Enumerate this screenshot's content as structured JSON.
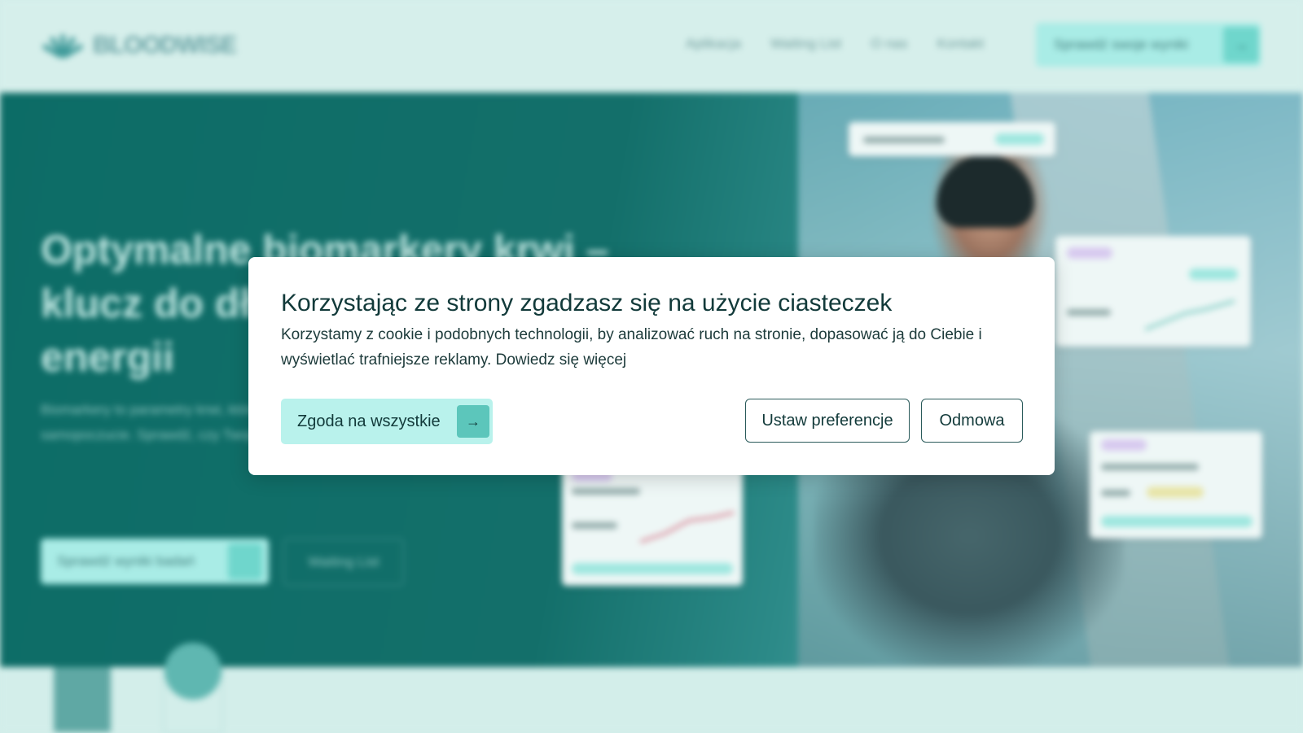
{
  "header": {
    "brand": "BLOODWISE",
    "nav": [
      "Aplikacja",
      "Waiting List",
      "O nas",
      "Kontakt"
    ],
    "cta_label": "Sprawdź swoje wyniki",
    "cta_icon": "arrow-right-icon"
  },
  "hero": {
    "title": "Optymalne biomarkery krwi – klucz do długiego zdrowia i energii",
    "text": "Biomarkery to parametry krwi, które pomagają monitorować stan zdrowia i samopoczucie. Sprawdź, czy Twoje wyniki są optymalne.",
    "cta_primary": "Sprawdź wyniki badań",
    "cta_secondary": "Waiting List"
  },
  "cookie_modal": {
    "title": "Korzystając ze strony zgadzasz się na użycie ciasteczek",
    "body": "Korzystamy z cookie i podobnych technologii, by analizować ruch na stronie, dopasować ją do Ciebie i wyświetlać trafniejsze reklamy. Dowiedz się więcej",
    "accept_label": "Zgoda na wszystkie",
    "accept_icon": "→",
    "preferences_label": "Ustaw preferencje",
    "refuse_label": "Odmowa"
  },
  "colors": {
    "accent": "#b9f2ec",
    "accent_dark": "#5cc6bb",
    "hero_bg": "#0c6c66",
    "page_bg": "#d3eeea",
    "text_dark": "#123a3a"
  }
}
